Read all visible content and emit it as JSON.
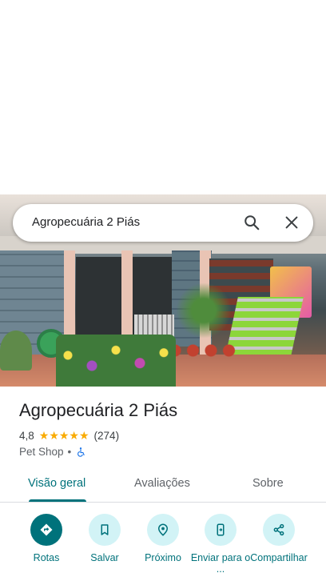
{
  "search": {
    "query": "Agropecuária 2 Piás"
  },
  "place": {
    "name": "Agropecuária 2 Piás",
    "rating": "4,8",
    "stars": "★★★★★",
    "review_count": "(274)",
    "category": "Pet Shop",
    "separator": "•"
  },
  "tabs": [
    {
      "label": "Visão geral",
      "active": true
    },
    {
      "label": "Avaliações",
      "active": false
    },
    {
      "label": "Sobre",
      "active": false
    }
  ],
  "actions": [
    {
      "label": "Rotas",
      "icon": "directions-icon"
    },
    {
      "label": "Salvar",
      "icon": "bookmark-icon"
    },
    {
      "label": "Próximo",
      "icon": "nearby-icon"
    },
    {
      "label": "Enviar para o ...",
      "icon": "send-to-phone-icon"
    },
    {
      "label": "Compartilhar",
      "icon": "share-icon"
    }
  ],
  "colors": {
    "accent": "#00727b",
    "action_bg": "#d2f3f6",
    "star": "#f9ab00"
  }
}
